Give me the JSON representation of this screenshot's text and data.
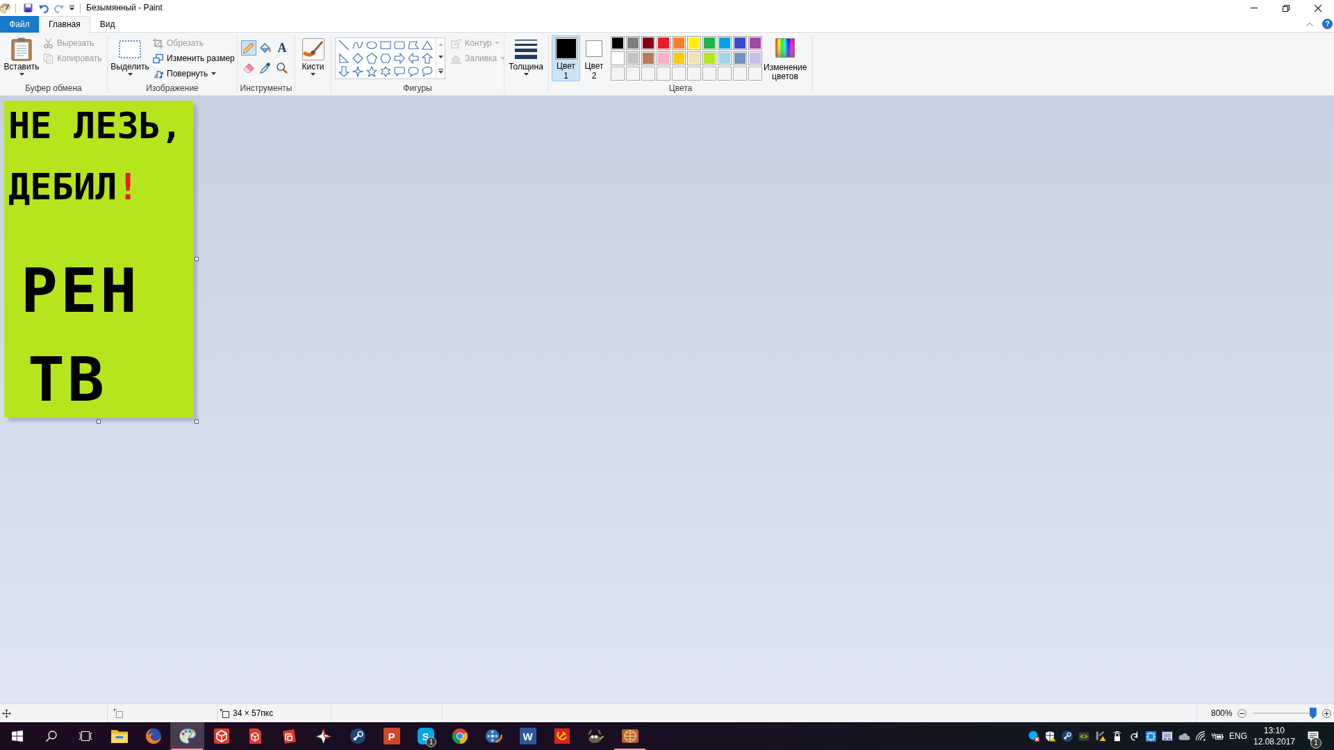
{
  "window": {
    "title": "Безымянный - Paint"
  },
  "tab_bar": {
    "tabs": [
      {
        "label": "Файл",
        "kind": "file",
        "selected": false
      },
      {
        "label": "Главная",
        "kind": "tab",
        "selected": true
      },
      {
        "label": "Вид",
        "kind": "tab",
        "selected": false
      }
    ],
    "help": "?"
  },
  "ribbon": {
    "clipboard": {
      "label": "Буфер обмена",
      "paste": "Вставить",
      "items": [
        {
          "kind": "cut",
          "label": "Вырезать",
          "disabled": true,
          "dropdown": false
        },
        {
          "kind": "copy",
          "label": "Копировать",
          "disabled": true,
          "dropdown": false
        }
      ]
    },
    "image": {
      "label": "Изображение",
      "select": "Выделить",
      "items": [
        {
          "kind": "crop",
          "label": "Обрезать",
          "disabled": true,
          "dropdown": false
        },
        {
          "kind": "resize",
          "label": "Изменить размер",
          "disabled": false,
          "dropdown": false
        },
        {
          "kind": "rotate",
          "label": "Повернуть",
          "disabled": false,
          "dropdown": true
        }
      ]
    },
    "tools": {
      "label": "Инструменты",
      "items": [
        {
          "kind": "pencil",
          "selected": true
        },
        {
          "kind": "fill",
          "selected": false
        },
        {
          "kind": "text",
          "glyph": "A",
          "selected": false
        },
        {
          "kind": "eraser",
          "selected": false
        },
        {
          "kind": "picker",
          "selected": false
        },
        {
          "kind": "magnifier",
          "selected": false
        }
      ]
    },
    "brushes": {
      "label": "Кисти"
    },
    "shapes": {
      "label": "Фигуры",
      "options": [
        {
          "kind": "outline",
          "label": "Контур",
          "disabled": true,
          "dropdown": true
        },
        {
          "kind": "fill",
          "label": "Заливка",
          "disabled": true,
          "dropdown": true
        }
      ]
    },
    "size": {
      "label": "Толщина"
    },
    "colors": {
      "label": "Цвета",
      "slots": [
        {
          "label": "Цвет",
          "number": "1",
          "color": "#000000",
          "selected": true
        },
        {
          "label": "Цвет",
          "number": "2",
          "color": "#ffffff",
          "selected": false
        }
      ],
      "palette": [
        {
          "kind": "swatch",
          "color": "#000000"
        },
        {
          "kind": "swatch",
          "color": "#7f7f7f"
        },
        {
          "kind": "swatch",
          "color": "#880015"
        },
        {
          "kind": "swatch",
          "color": "#ed1c24"
        },
        {
          "kind": "swatch",
          "color": "#ff7f27"
        },
        {
          "kind": "swatch",
          "color": "#fff200"
        },
        {
          "kind": "swatch",
          "color": "#22b14c"
        },
        {
          "kind": "swatch",
          "color": "#00a2e8"
        },
        {
          "kind": "swatch",
          "color": "#3f48cc"
        },
        {
          "kind": "swatch",
          "color": "#a349a4"
        },
        {
          "kind": "swatch",
          "color": "#ffffff"
        },
        {
          "kind": "swatch",
          "color": "#c3c3c3"
        },
        {
          "kind": "swatch",
          "color": "#b97a57"
        },
        {
          "kind": "swatch",
          "color": "#ffaec9"
        },
        {
          "kind": "swatch",
          "color": "#ffc90e"
        },
        {
          "kind": "swatch",
          "color": "#efe4b0"
        },
        {
          "kind": "swatch",
          "color": "#b5e61d"
        },
        {
          "kind": "swatch",
          "color": "#99d9ea"
        },
        {
          "kind": "swatch",
          "color": "#7092be"
        },
        {
          "kind": "swatch",
          "color": "#c8bfe7"
        },
        {
          "kind": "empty"
        },
        {
          "kind": "empty"
        },
        {
          "kind": "empty"
        },
        {
          "kind": "empty"
        },
        {
          "kind": "empty"
        },
        {
          "kind": "empty"
        },
        {
          "kind": "empty"
        },
        {
          "kind": "empty"
        },
        {
          "kind": "empty"
        },
        {
          "kind": "empty"
        }
      ],
      "edit": "Изменение цветов"
    }
  },
  "canvas": {
    "lines": [
      {
        "segments": [
          {
            "text": "НЕ ЛЕЗЬ,",
            "color": "#000000"
          }
        ]
      },
      {
        "segments": [
          {
            "text": "ДЕБИЛ",
            "color": "#000000"
          },
          {
            "text": "!",
            "color": "#ed1c24"
          }
        ]
      },
      {
        "segments": [
          {
            "text": "РЕН",
            "color": "#000000"
          }
        ]
      },
      {
        "segments": [
          {
            "text": "ТВ",
            "color": "#000000"
          }
        ]
      }
    ]
  },
  "status_bar": {
    "canvas_size": "34 × 57пкс",
    "zoom": "800%",
    "zoom_slider": {
      "level": 1
    }
  },
  "taskbar": {
    "apps": [
      {
        "kind": "folder",
        "selected": false,
        "running": false
      },
      {
        "kind": "fox-globe",
        "selected": false,
        "running": false
      },
      {
        "kind": "palette",
        "selected": true,
        "running": true
      },
      {
        "kind": "cube",
        "selected": false,
        "running": false
      },
      {
        "kind": "cube-page",
        "selected": false,
        "running": false
      },
      {
        "kind": "frame",
        "selected": false,
        "running": false
      },
      {
        "kind": "star",
        "selected": false,
        "running": false
      },
      {
        "kind": "disc",
        "selected": false,
        "running": false
      },
      {
        "kind": "slides",
        "glyph": "P",
        "selected": false,
        "running": false
      },
      {
        "kind": "chat",
        "glyph": "S",
        "badge": "1",
        "selected": false,
        "running": false
      },
      {
        "kind": "segmented-circle",
        "selected": false,
        "running": false
      },
      {
        "kind": "film",
        "selected": false,
        "running": false
      },
      {
        "kind": "document",
        "glyph": "W",
        "selected": false,
        "running": false
      },
      {
        "kind": "emblem",
        "selected": false,
        "running": false
      },
      {
        "kind": "animal",
        "selected": false,
        "running": false
      },
      {
        "kind": "grid-globe",
        "selected": false,
        "running": true
      }
    ],
    "tray": {
      "language": "ENG",
      "time": "13:10",
      "date": "12.08.2017",
      "notifications": "1"
    }
  }
}
